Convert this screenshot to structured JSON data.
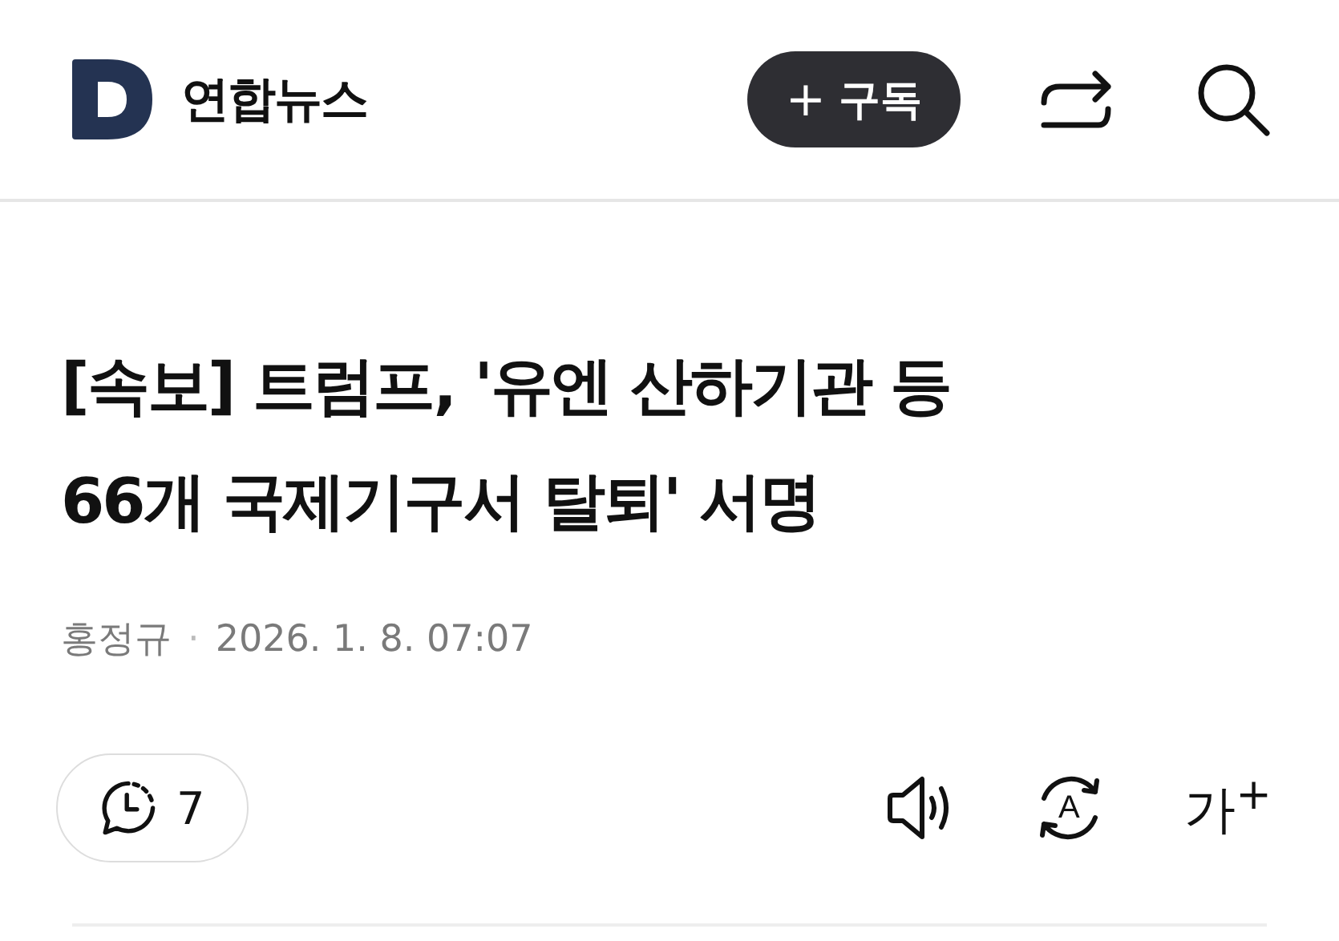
{
  "header": {
    "brand": "연합뉴스",
    "subscribe_button": {
      "icon": "+",
      "label": "구독"
    }
  },
  "article": {
    "title": "[속보] 트럼프, '유엔 산하기관 등 66개 국제기구서 탈퇴' 서명",
    "author": "홍정규",
    "separator": "·",
    "date": "2026. 1. 8. 07:07"
  },
  "toolbar": {
    "comment_count": "7",
    "translate_label": "A",
    "font_size_label": "가$^{+}$"
  }
}
